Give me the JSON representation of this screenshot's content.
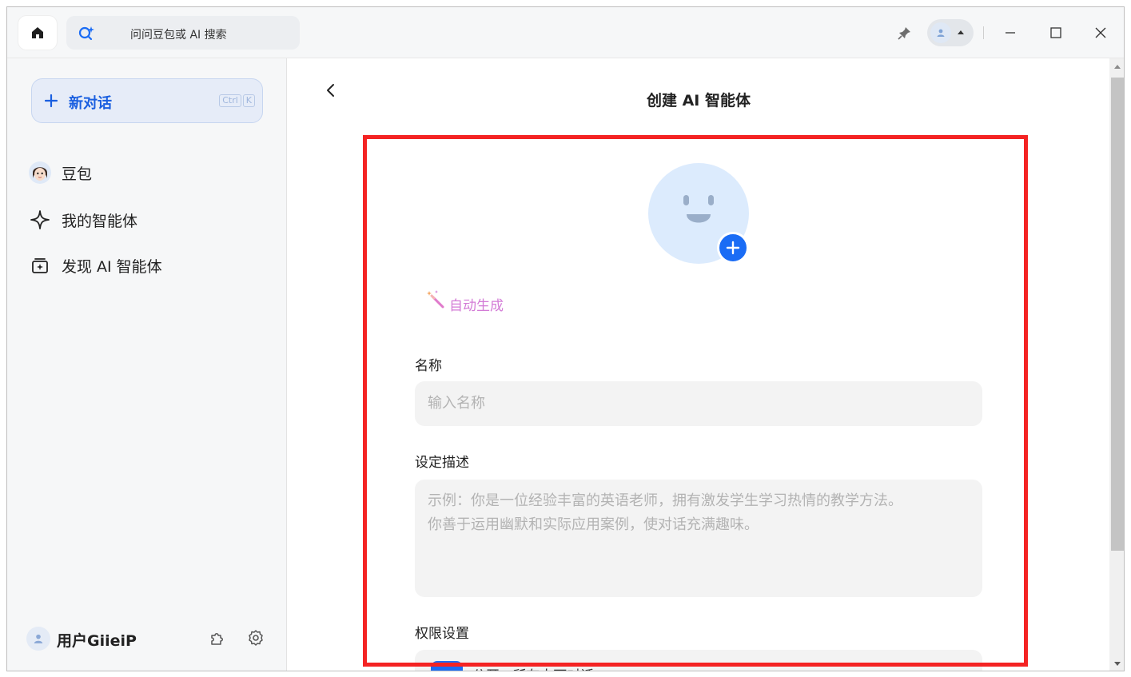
{
  "titlebar": {
    "search_placeholder": "问问豆包或 AI 搜索"
  },
  "sidebar": {
    "new_chat_label": "新对话",
    "shortcut_keys": [
      "Ctrl",
      "K"
    ],
    "items": [
      {
        "label": "豆包",
        "icon": "doubao-avatar-icon"
      },
      {
        "label": "我的智能体",
        "icon": "sparkle-icon"
      },
      {
        "label": "发现 AI 智能体",
        "icon": "discover-icon"
      }
    ],
    "user_name": "用户GiieiP"
  },
  "main": {
    "title": "创建 AI 智能体",
    "auto_generate": "自动生成",
    "name_label": "名称",
    "name_placeholder": "输入名称",
    "desc_label": "设定描述",
    "desc_placeholder_line1": "示例：你是一位经验丰富的英语老师，拥有激发学生学习热情的教学方法。",
    "desc_placeholder_line2": "你善于运用幽默和实际应用案例，使对话充满趣味。",
    "permission_label": "权限设置",
    "permission_value": "公开 · 所有人可对话"
  },
  "colors": {
    "accent": "#1a6cf5",
    "highlight_frame": "#f42323",
    "auto_generate": "#d37bd6"
  }
}
